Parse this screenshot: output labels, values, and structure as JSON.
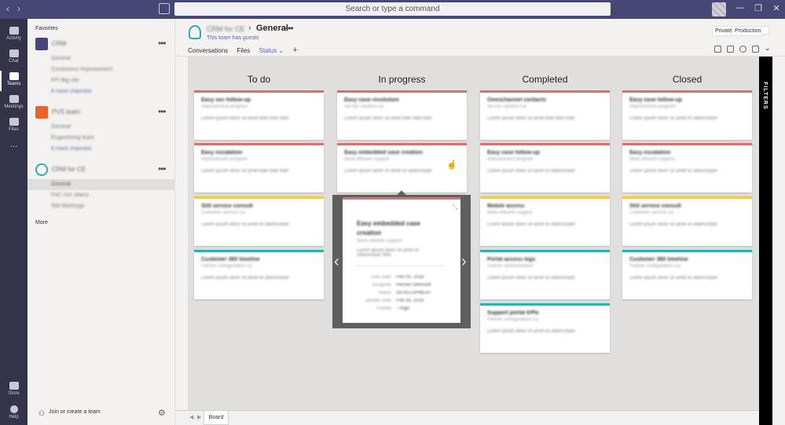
{
  "titlebar": {
    "search_placeholder": "Search or type a command"
  },
  "rail": {
    "items": [
      {
        "label": "Activity",
        "icon": "bell-icon"
      },
      {
        "label": "Chat",
        "icon": "chat-icon"
      },
      {
        "label": "Teams",
        "icon": "teams-icon"
      },
      {
        "label": "Meetings",
        "icon": "calendar-icon"
      },
      {
        "label": "Files",
        "icon": "file-icon"
      },
      {
        "label": "...",
        "icon": "more-icon"
      },
      {
        "label": "Store",
        "icon": "store-icon"
      },
      {
        "label": "Help",
        "icon": "help-icon"
      }
    ]
  },
  "panel": {
    "favorites_label": "Favorites",
    "teams": [
      {
        "name": "CRM",
        "color": "#464775",
        "channels": [
          "General",
          "Continuous Improvement",
          "FPI Big site",
          "6 more channels"
        ]
      },
      {
        "name": "PVS team",
        "color": "#e8622c",
        "channels": [
          "General",
          "Engineering team",
          "6 more channels"
        ]
      },
      {
        "name": "CRM for CE",
        "color": "#2ea8b7",
        "channels": [
          "General",
          "PoC con Jeans",
          "Still Workings"
        ]
      }
    ],
    "more_label": "More",
    "join_label": "Join or create a team"
  },
  "header": {
    "team_name": "CRM for CE",
    "channel_name": "General",
    "guests_note": "This team has guests",
    "tabs": [
      "Conversations",
      "Files",
      "Status ⌄"
    ],
    "tag_private": "Private",
    "tag_production": "Production"
  },
  "board": {
    "columns": [
      {
        "title": "To do",
        "cards": [
          {
            "title": "Easy sec follow-up",
            "sub": "Improvement program",
            "desc": "Lorem ipsum dolor sit amet blah blah blah",
            "color": "red"
          },
          {
            "title": "Easy escalation",
            "sub": "Improvement program",
            "desc": "Lorem ipsum dolor sit amet blah blah blah",
            "color": "red"
          },
          {
            "title": "Still service consult",
            "sub": "Customer service CE",
            "desc": "Lorem ipsum dolor sit amet et ullamcorper",
            "color": "yellow"
          },
          {
            "title": "Customer 360 timeline",
            "sub": "Partner configuration CE",
            "desc": "Lorem ipsum dolor sit amet et ullamcorper",
            "color": "teal"
          }
        ]
      },
      {
        "title": "In progress",
        "cards": [
          {
            "title": "Easy case resolution",
            "sub": "Ad hoc solution CE",
            "desc": "Lorem ipsum dolor sit amet blah blah blah",
            "color": "red"
          },
          {
            "title": "Easy embedded case creation",
            "sub": "Work efficient support",
            "desc": "Lorem ipsum dolor sit amet et ullamcorper",
            "color": "red"
          }
        ]
      },
      {
        "title": "Completed",
        "cards": [
          {
            "title": "Omnichannel contacts",
            "sub": "Ad hoc solution CE",
            "desc": "Lorem ipsum dolor sit amet blah blah blah",
            "color": "red"
          },
          {
            "title": "Easy case follow-up",
            "sub": "Improvement program",
            "desc": "Lorem ipsum dolor sit amet et ullamcorper",
            "color": "red"
          },
          {
            "title": "Mobile access",
            "sub": "Work efficient support",
            "desc": "Lorem ipsum dolor sit amet et ullamcorper",
            "color": "yellow"
          },
          {
            "title": "Portal access logs",
            "sub": "Partner administration",
            "desc": "Lorem ipsum dolor sit amet et ullamcorper",
            "color": "teal"
          },
          {
            "title": "Support portal KPIs",
            "sub": "Partner configuration CE",
            "desc": "Lorem ipsum dolor sit amet et ullamcorper",
            "color": "teal"
          }
        ]
      },
      {
        "title": "Closed",
        "cards": [
          {
            "title": "Easy case follow-up",
            "sub": "Improvement program",
            "desc": "Lorem ipsum dolor sit amet et ullamcorper",
            "color": "red"
          },
          {
            "title": "Easy escalation",
            "sub": "Work efficient support",
            "desc": "Lorem ipsum dolor sit amet et ullamcorper",
            "color": "red"
          },
          {
            "title": "Still service consult",
            "sub": "Customer service CE",
            "desc": "Lorem ipsum dolor sit amet et ullamcorper",
            "color": "yellow"
          },
          {
            "title": "Customer 360 timeline",
            "sub": "Partner configuration CE",
            "desc": "Lorem ipsum dolor sit amet et ullamcorper",
            "color": "teal"
          }
        ]
      }
    ],
    "detail": {
      "title": "Easy embedded case creation",
      "sub": "Work efficient support",
      "desc": "Lorem ipsum dolor sit amet et ullamcorper felis",
      "rows": [
        {
          "k": "Due Date",
          "v": "Feb 03, 2018"
        },
        {
          "k": "Assignee",
          "v": "Pernell Odonnell"
        },
        {
          "k": "Status",
          "v": "DEVELOPMENT"
        },
        {
          "k": "Update Date",
          "v": "Feb 05, 2018"
        },
        {
          "k": "Priority",
          "v": "↑ High"
        }
      ]
    },
    "filters_label": "FILTERS",
    "sheet_tab": "Board"
  }
}
